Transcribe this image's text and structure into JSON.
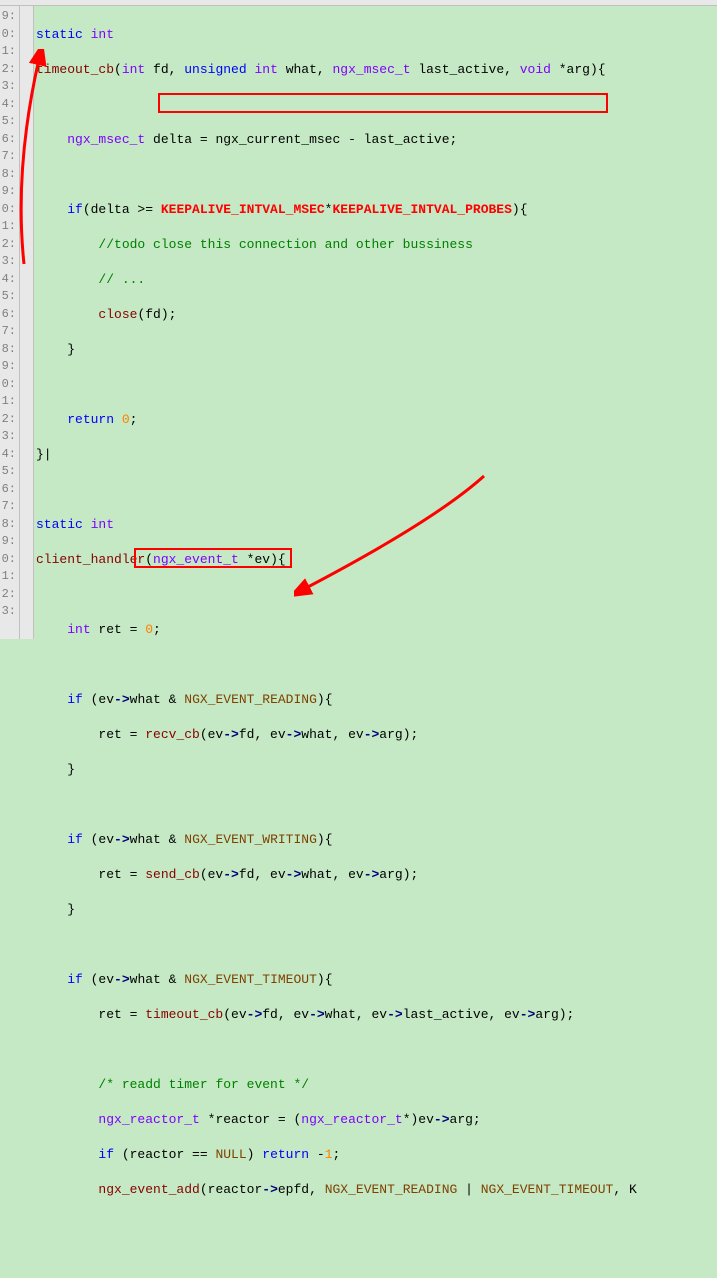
{
  "gutter": [
    "9:",
    "0:",
    "1:",
    "2:",
    "3:",
    "4:",
    "5:",
    "6:",
    "7:",
    "8:",
    "9:",
    "0:",
    "1:",
    "2:",
    "3:",
    "4:",
    "5:",
    "6:",
    "7:",
    "8:",
    "9:",
    "0:",
    "1:",
    "2:",
    "3:",
    "4:",
    "5:",
    "6:",
    "7:",
    "8:",
    "9:",
    "0:",
    "1:",
    "2:",
    "3:"
  ],
  "code": {
    "l1_a": "static",
    "l1_b": " int",
    "l2_a": "timeout_cb",
    "l2_b": "(",
    "l2_c": "int",
    "l2_d": " fd, ",
    "l2_e": "unsigned",
    "l2_f": " int",
    "l2_g": " what, ",
    "l2_h": "ngx_msec_t",
    "l2_i": " last_active, ",
    "l2_j": "void",
    "l2_k": " *arg){",
    "l3": "",
    "l4_a": "    ",
    "l4_b": "ngx_msec_t",
    "l4_c": " delta = ",
    "l4_d": "ngx_current_msec",
    "l4_e": " - last_active;",
    "l5": "",
    "l6_a": "    ",
    "l6_b": "if",
    "l6_c": "(delta >= ",
    "l6_d": "KEEPALIVE_INTVAL_MSEC",
    "l6_e": "*",
    "l6_f": "KEEPALIVE_INTVAL_PROBES",
    "l6_g": "){",
    "l7_a": "        ",
    "l7_b": "//todo close this connection and other bussiness",
    "l8_a": "        ",
    "l8_b": "// ...",
    "l9_a": "        ",
    "l9_b": "close",
    "l9_c": "(fd);",
    "l10": "    }",
    "l11": "",
    "l12_a": "    ",
    "l12_b": "return",
    "l12_c": " ",
    "l12_d": "0",
    "l12_e": ";",
    "l13": "}|",
    "l14": "",
    "l15_a": "static",
    "l15_b": " int",
    "l16_a": "client_handler",
    "l16_b": "(",
    "l16_c": "ngx_event_t",
    "l16_d": " *ev){",
    "l17": "",
    "l18_a": "    ",
    "l18_b": "int",
    "l18_c": " ret = ",
    "l18_d": "0",
    "l18_e": ";",
    "l19": "",
    "l20_a": "    ",
    "l20_b": "if",
    "l20_c": " (ev",
    "l20_d": "->",
    "l20_e": "what & ",
    "l20_f": "NGX_EVENT_READING",
    "l20_g": "){",
    "l21_a": "        ret = ",
    "l21_b": "recv_cb",
    "l21_c": "(ev",
    "l21_d": "->",
    "l21_e": "fd, ev",
    "l21_f": "->",
    "l21_g": "what, ev",
    "l21_h": "->",
    "l21_i": "arg);",
    "l22": "    }",
    "l23": "",
    "l24_a": "    ",
    "l24_b": "if",
    "l24_c": " (ev",
    "l24_d": "->",
    "l24_e": "what & ",
    "l24_f": "NGX_EVENT_WRITING",
    "l24_g": "){",
    "l25_a": "        ret = ",
    "l25_b": "send_cb",
    "l25_c": "(ev",
    "l25_d": "->",
    "l25_e": "fd, ev",
    "l25_f": "->",
    "l25_g": "what, ev",
    "l25_h": "->",
    "l25_i": "arg);",
    "l26": "    }",
    "l27": "",
    "l28_a": "    ",
    "l28_b": "if",
    "l28_c": " (ev",
    "l28_d": "->",
    "l28_e": "what & ",
    "l28_f": "NGX_EVENT_TIMEOUT",
    "l28_g": "){",
    "l29_a": "        ret = ",
    "l29_b": "timeout_cb",
    "l29_c": "(ev",
    "l29_d": "->",
    "l29_e": "fd, ev",
    "l29_f": "->",
    "l29_g": "what, ev",
    "l29_h": "->",
    "l29_i": "last_active, ev",
    "l29_j": "->",
    "l29_k": "arg);",
    "l30": "",
    "l31_a": "        ",
    "l31_b": "/* readd timer for event */",
    "l32_a": "        ",
    "l32_b": "ngx_reactor_t",
    "l32_c": " *reactor = (",
    "l32_d": "ngx_reactor_t",
    "l32_e": "*)ev",
    "l32_f": "->",
    "l32_g": "arg;",
    "l33_a": "        ",
    "l33_b": "if",
    "l33_c": " (reactor == ",
    "l33_d": "NULL",
    "l33_e": ") ",
    "l33_f": "return",
    "l33_g": " -",
    "l33_h": "1",
    "l33_i": ";",
    "l34_a": "        ",
    "l34_b": "ngx_event_add",
    "l34_c": "(reactor",
    "l34_d": "->",
    "l34_e": "epfd, ",
    "l34_f": "NGX_EVENT_READING",
    "l34_g": " | ",
    "l34_h": "NGX_EVENT_TIMEOUT",
    "l34_i": ", K"
  }
}
